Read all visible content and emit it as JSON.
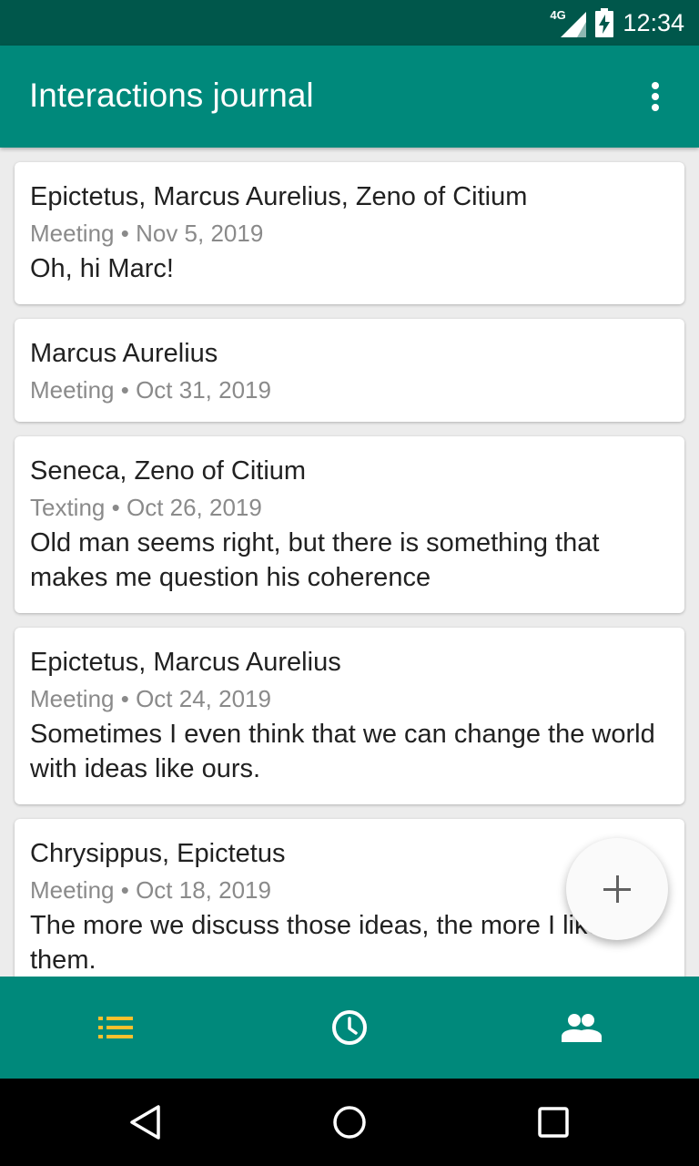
{
  "status_bar": {
    "network": "4G",
    "time": "12:34"
  },
  "app_bar": {
    "title": "Interactions journal",
    "overflow_icon": "more-vert-icon"
  },
  "interactions": [
    {
      "people": "Epictetus, Marcus Aurelius, Zeno of Citium",
      "type": "Meeting",
      "date": "Nov 5, 2019",
      "note": "Oh, hi Marc!"
    },
    {
      "people": "Marcus Aurelius",
      "type": "Meeting",
      "date": "Oct 31, 2019",
      "note": ""
    },
    {
      "people": "Seneca, Zeno of Citium",
      "type": "Texting",
      "date": "Oct 26, 2019",
      "note": "Old man seems right, but there is something that makes me question his coherence"
    },
    {
      "people": "Epictetus, Marcus Aurelius",
      "type": "Meeting",
      "date": "Oct 24, 2019",
      "note": "Sometimes I even think that we can change the world with ideas like ours."
    },
    {
      "people": "Chrysippus, Epictetus",
      "type": "Meeting",
      "date": "Oct 18, 2019",
      "note": "The more we discuss those ideas, the more I like them."
    }
  ],
  "meta_separator": "•",
  "fab": {
    "icon": "add-icon"
  },
  "bottom_nav": [
    {
      "icon": "list-icon",
      "selected": true
    },
    {
      "icon": "history-icon",
      "selected": false
    },
    {
      "icon": "people-icon",
      "selected": false
    }
  ],
  "colors": {
    "primary": "#00897b",
    "primary_dark": "#00574b",
    "accent": "#fbc02d",
    "secondary_text": "#8a8a8a"
  }
}
